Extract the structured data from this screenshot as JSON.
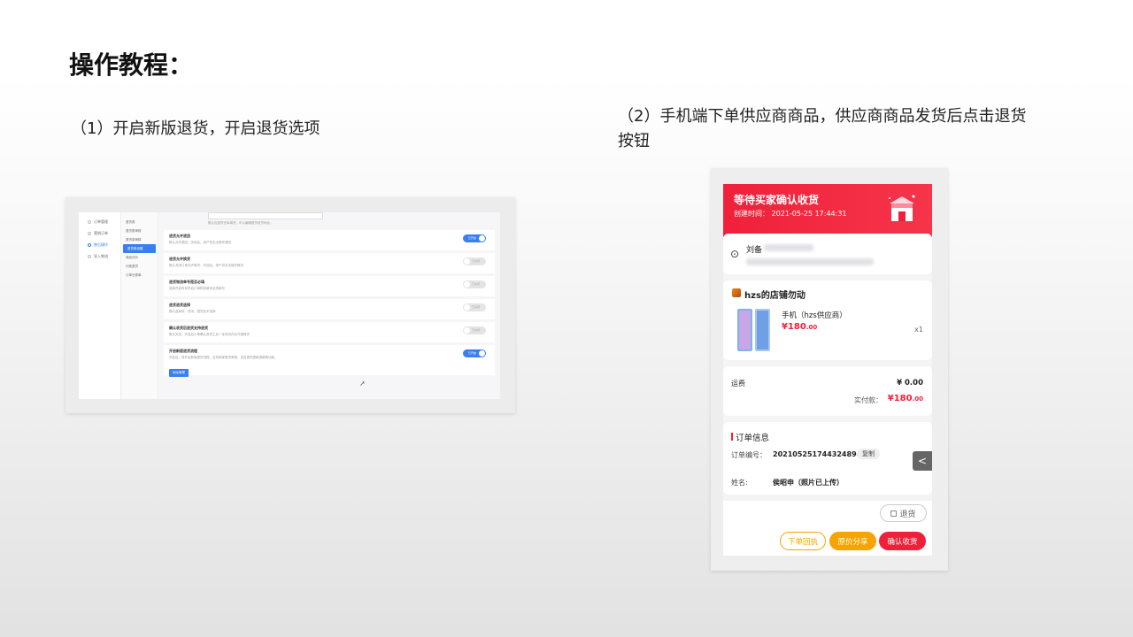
{
  "slide": {
    "title": "操作教程：",
    "step1": "（1）开启新版退货，开启退货选项",
    "step2": "（2）手机端下单供应商商品，供应商商品发货后点击退货按钮"
  },
  "admin": {
    "nav": [
      "订单管理",
      "营销订单",
      "售后操作",
      "导入物流"
    ],
    "nav_active_index": 2,
    "sub_group": "退货类",
    "sub": [
      "退货类审核",
      "退货类审核",
      "退货类设置",
      "商品评价",
      "行政退货",
      "订单分类单"
    ],
    "top_note": "默认包退货仓库填写，可以编辑退货收货地址。",
    "settings": [
      {
        "title": "退货允许退回",
        "desc": "默认允许退回，关闭后，用户将无法操作退回",
        "on": true,
        "label": "已开启"
      },
      {
        "title": "退货允许换货",
        "desc": "默认关闭订单允许换货，关闭后，用户将无法操作换货",
        "on": false,
        "label": "已关闭"
      },
      {
        "title": "退货物流单号是否必填",
        "desc": "选择开启时将开启订单物流单号必须填写",
        "on": false,
        "label": "已关闭"
      },
      {
        "title": "退货退货选择",
        "desc": "默认选择将，关闭，退货后不选择",
        "on": false,
        "label": "已关闭"
      },
      {
        "title": "确认收货后退货支持退货",
        "desc": "默认关闭，开启后订单确认收货之后一定时间内允许退换货",
        "on": false,
        "label": "已关闭"
      },
      {
        "title": "开启新版退货流程",
        "desc": "开启后，将开启新版退货流程，支持商家退货审核，支持退货退款退款等功能。",
        "on": true,
        "label": "已开启",
        "button": "地址管理"
      }
    ]
  },
  "mobile": {
    "status_title": "等待买家确认收货",
    "created_time": "创建时间： 2021-05-25 17:44:31",
    "receiver_name": "刘备",
    "shop_name": "hzs的店铺勿动",
    "shop_arrow": "›",
    "goods_title": "手机（hzs供应商）",
    "goods_price": "¥180",
    "goods_price_cents": ".00",
    "goods_qty": "x1",
    "shipping_label": "运费",
    "shipping_value": "¥ 0.00",
    "paid_label": "实付款：",
    "paid_value": "¥180",
    "paid_value_cents": ".00",
    "info_title": "订单信息",
    "order_no_label": "订单编号：",
    "order_no": "20210525174432​4894",
    "copy_label": "复制",
    "name_label": "姓名:",
    "name_value": "侯昭申（照片已上传）",
    "back_label": "<",
    "return_label": "退货",
    "btn_receipt": "下单回执",
    "btn_share": "原价分享",
    "btn_confirm": "确认收货"
  },
  "colors": {
    "accent_red": "#f0203a",
    "accent_orange": "#f7a400",
    "admin_blue": "#3a7ef0"
  }
}
